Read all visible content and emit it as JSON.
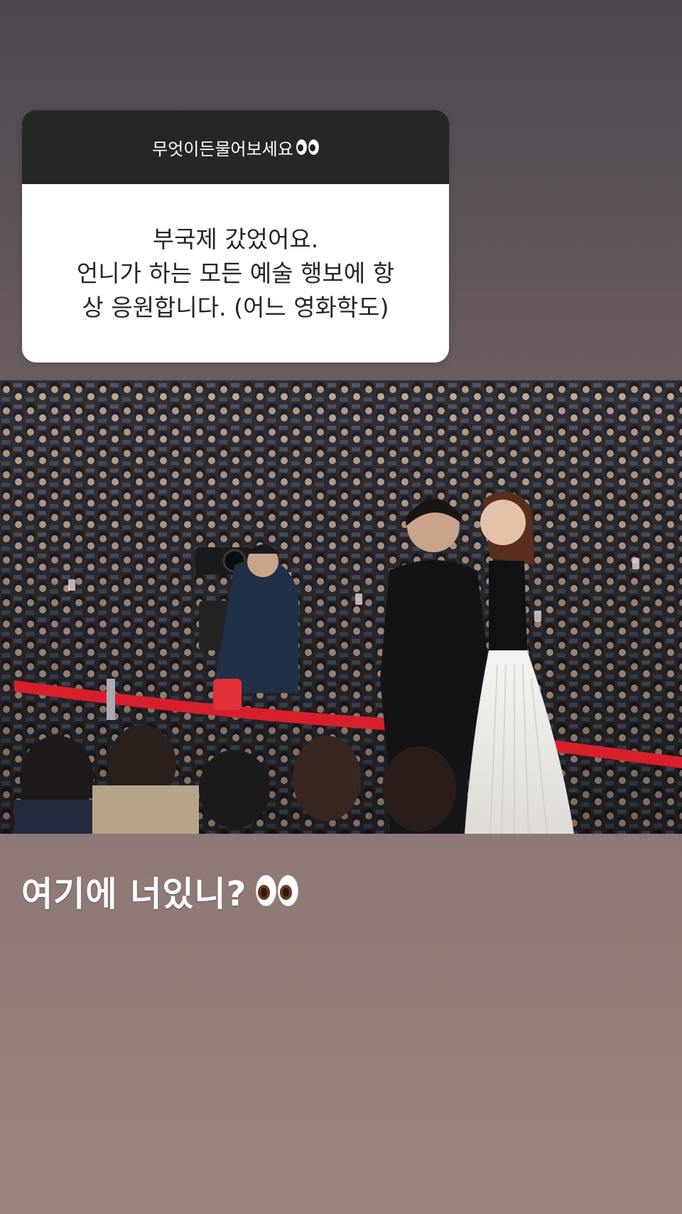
{
  "question_sticker": {
    "prompt": "무엇이든물어보세요",
    "prompt_emoji": "eyes-icon",
    "answer_lines": [
      "부국제 갔었어요.",
      "언니가 하는 모든 예술 행보에 항",
      "상 응원합니다. (어느 영화학도)"
    ]
  },
  "photo": {
    "subject": "red carpet event crowd photo"
  },
  "caption": {
    "text": "여기에 너있니?",
    "emoji": "eyes-icon"
  },
  "colors": {
    "header_bg": "#262626",
    "card_bg": "#ffffff",
    "barrier_red": "#d8202c"
  }
}
